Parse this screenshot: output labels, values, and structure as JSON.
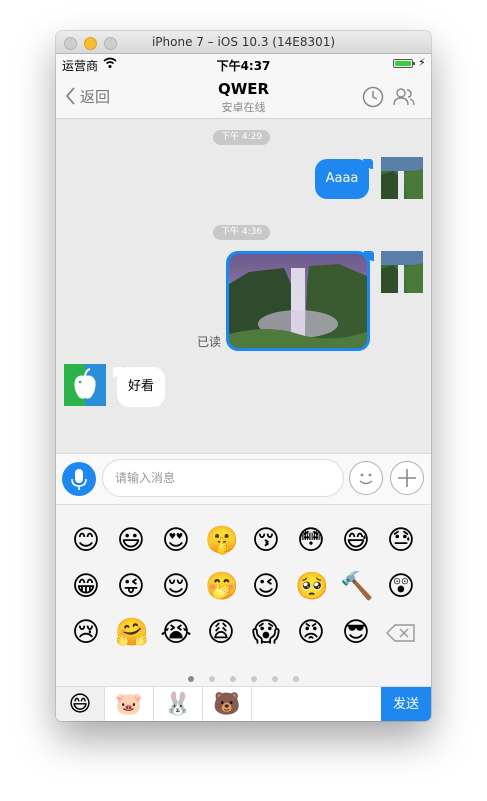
{
  "window": {
    "title": "iPhone 7 – iOS 10.3 (14E8301)"
  },
  "status": {
    "carrier": "运营商",
    "time": "下午4:37"
  },
  "nav": {
    "back_label": "返回",
    "title": "QWER",
    "subtitle": "安卓在线"
  },
  "messages": [
    {
      "type": "time",
      "text": "下午 4:29"
    },
    {
      "type": "outgoing_text",
      "text": "Aaaa"
    },
    {
      "type": "time",
      "text": "下午 4:36"
    },
    {
      "type": "outgoing_image",
      "image": "waterfall landscape",
      "read_label": "已读"
    },
    {
      "type": "incoming_text",
      "text": "好看",
      "avatar": "android-apple-icon"
    }
  ],
  "input": {
    "placeholder": "请输入消息"
  },
  "emoji_panel": {
    "rows": [
      [
        "😊",
        "😃",
        "😍",
        "🤫",
        "😚",
        "😳",
        "😅",
        "😓"
      ],
      [
        "😁",
        "😜",
        "😌",
        "🤭",
        "😉",
        "🥺",
        "🔨",
        "😲"
      ],
      [
        "😢",
        "🤗",
        "😭",
        "😩",
        "😱",
        "😡",
        "😎"
      ]
    ],
    "pages": 6,
    "active_page": 0
  },
  "categories": [
    "😄",
    "🐷",
    "🐰",
    "🐻"
  ],
  "send_label": "发送",
  "colors": {
    "accent": "#1e88f0",
    "chat_bg": "#eaeaea",
    "battery": "#3ccf3c"
  }
}
